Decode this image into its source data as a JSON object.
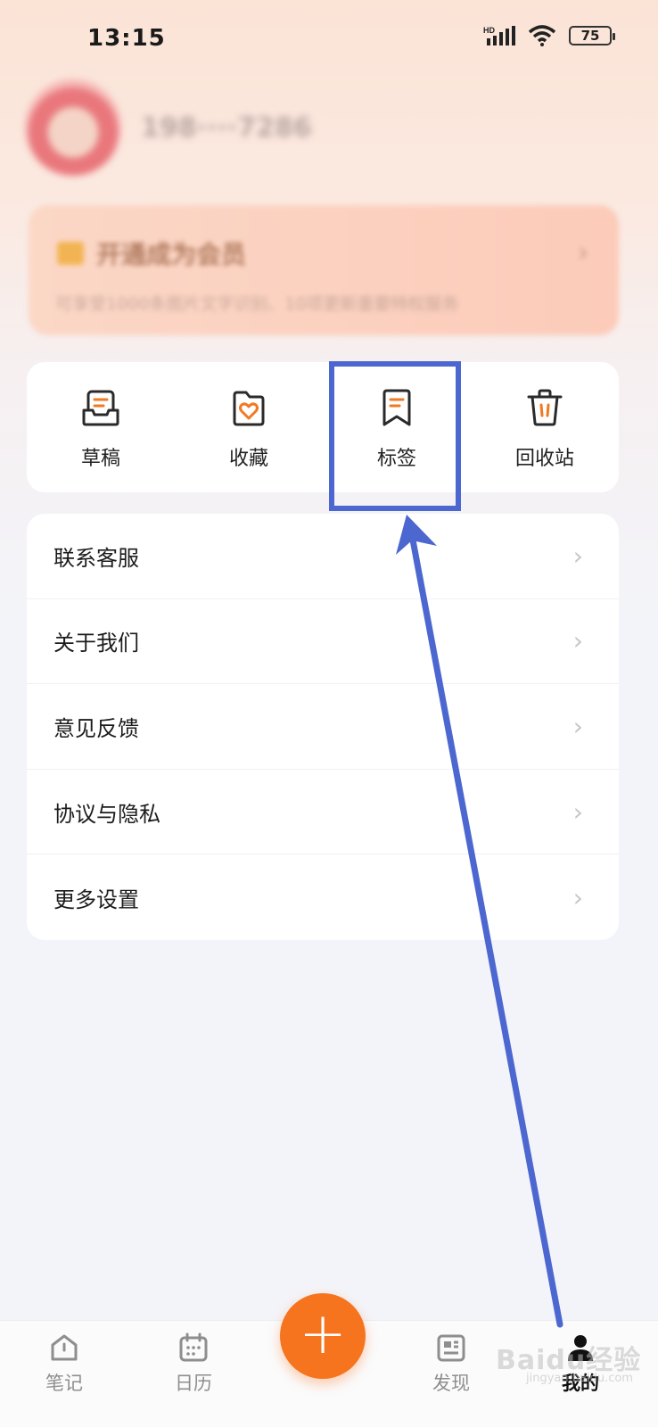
{
  "status_bar": {
    "time": "13:15",
    "network": "HD",
    "battery": "75"
  },
  "profile": {
    "phone": "198····7286"
  },
  "vip": {
    "title": "开通成为会员",
    "desc": "可享受1000条图片文字识别、10项更新重要特权服务"
  },
  "quick_actions": [
    {
      "label": "草稿",
      "icon": "draft-icon"
    },
    {
      "label": "收藏",
      "icon": "favorite-icon"
    },
    {
      "label": "标签",
      "icon": "bookmark-icon"
    },
    {
      "label": "回收站",
      "icon": "trash-icon"
    }
  ],
  "menu": [
    {
      "label": "联系客服"
    },
    {
      "label": "关于我们"
    },
    {
      "label": "意见反馈"
    },
    {
      "label": "协议与隐私"
    },
    {
      "label": "更多设置"
    }
  ],
  "chevron": "›",
  "bottom_nav": [
    {
      "label": "笔记",
      "active": false
    },
    {
      "label": "日历",
      "active": false
    },
    {
      "label": "发现",
      "active": false
    },
    {
      "label": "我的",
      "active": true
    }
  ],
  "fab_label": "+",
  "watermark": {
    "main": "Baidu经验",
    "sub": "jingyan.baidu.com"
  },
  "colors": {
    "accent": "#f7741e",
    "annotation": "#4c67d0"
  }
}
